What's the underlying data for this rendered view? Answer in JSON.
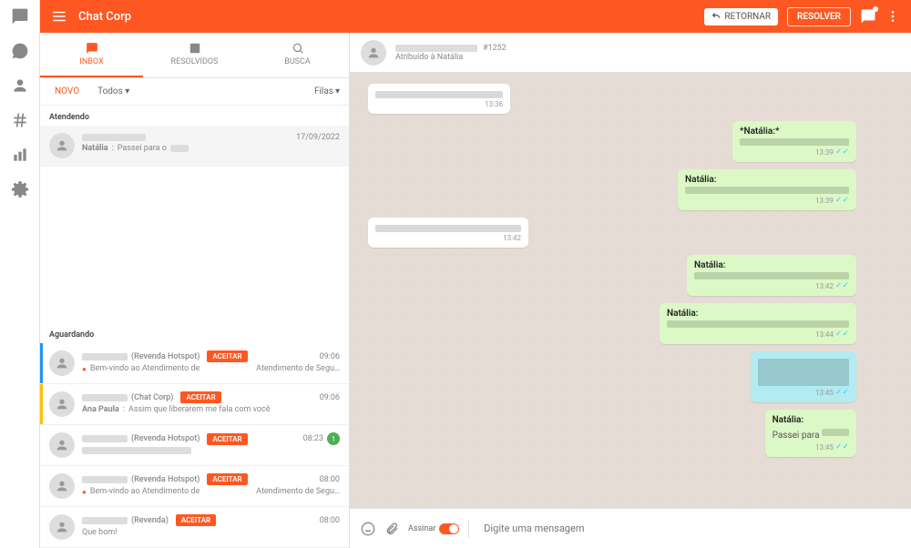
{
  "header": {
    "title": "Chat Corp",
    "return_label": "RETORNAR",
    "resolve_label": "RESOLVER"
  },
  "tabs": {
    "inbox": "INBOX",
    "resolved": "RESOLVIDOS",
    "search": "BUSCA"
  },
  "filters": {
    "new": "NOVO",
    "all": "Todos",
    "queues": "Filas"
  },
  "sections": {
    "attending": "Atendendo",
    "waiting": "Aguardando"
  },
  "attending": [
    {
      "name": "Natália",
      "preview": "Passei para o",
      "time": "17/09/2022"
    }
  ],
  "waiting": [
    {
      "source": "(Revenda Hotspot)",
      "time": "09:06",
      "accept": "ACEITAR",
      "line2a": "Bem-vindo ao Atendimento de",
      "line2b": "Atendimento de Segu…"
    },
    {
      "source": "(Chat Corp)",
      "agent": "Ana Paula",
      "time": "09:06",
      "accept": "ACEITAR",
      "line2": "Assim que liberarem me fala com você"
    },
    {
      "source": "(Revenda Hotspot)",
      "time": "08:23",
      "accept": "ACEITAR",
      "badge": "1"
    },
    {
      "source": "(Revenda Hotspot)",
      "time": "08:00",
      "accept": "ACEITAR",
      "line2a": "Bem-vindo ao Atendimento de",
      "line2b": "Atendimento de Segu…"
    },
    {
      "source": "(Revenda)",
      "time": "08:00",
      "accept": "ACEITAR",
      "line2": "Que bom!"
    }
  ],
  "chat": {
    "ticket": "#1252",
    "assigned": "Atribuído à Natália"
  },
  "msgs": [
    {
      "side": "in",
      "time": "13:36"
    },
    {
      "side": "out",
      "name": "*Natália:*",
      "time": "13:39"
    },
    {
      "side": "out",
      "name": "Natália:",
      "time": "13:39"
    },
    {
      "side": "in",
      "time": "13:42"
    },
    {
      "side": "out",
      "name": "Natália:",
      "time": "13:42"
    },
    {
      "side": "out",
      "name": "Natália:",
      "time": "13:44"
    },
    {
      "side": "out",
      "time": "13:45"
    },
    {
      "side": "out",
      "name": "Natália:",
      "body": "Passei para",
      "time": "13:45"
    }
  ],
  "composer": {
    "sign": "Assinar",
    "placeholder": "Digite uma mensagem"
  }
}
